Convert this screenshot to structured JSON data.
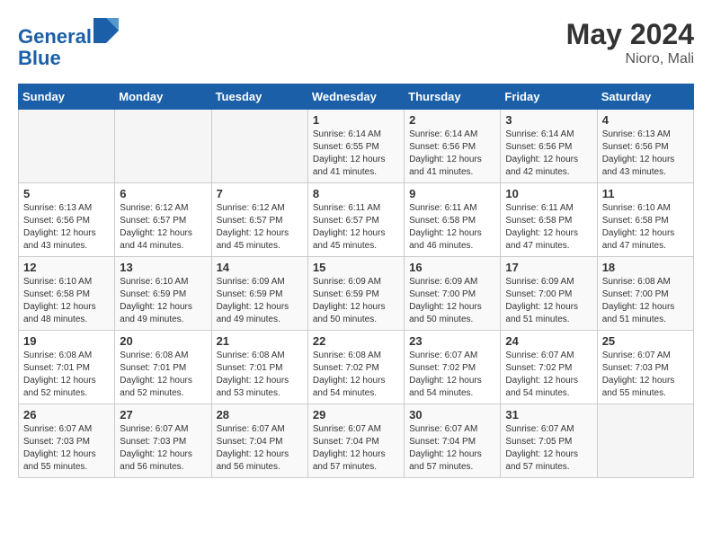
{
  "header": {
    "logo_line1": "General",
    "logo_line2": "Blue",
    "month_year": "May 2024",
    "location": "Nioro, Mali"
  },
  "weekdays": [
    "Sunday",
    "Monday",
    "Tuesday",
    "Wednesday",
    "Thursday",
    "Friday",
    "Saturday"
  ],
  "weeks": [
    [
      {
        "day": "",
        "info": ""
      },
      {
        "day": "",
        "info": ""
      },
      {
        "day": "",
        "info": ""
      },
      {
        "day": "1",
        "info": "Sunrise: 6:14 AM\nSunset: 6:55 PM\nDaylight: 12 hours\nand 41 minutes."
      },
      {
        "day": "2",
        "info": "Sunrise: 6:14 AM\nSunset: 6:56 PM\nDaylight: 12 hours\nand 41 minutes."
      },
      {
        "day": "3",
        "info": "Sunrise: 6:14 AM\nSunset: 6:56 PM\nDaylight: 12 hours\nand 42 minutes."
      },
      {
        "day": "4",
        "info": "Sunrise: 6:13 AM\nSunset: 6:56 PM\nDaylight: 12 hours\nand 43 minutes."
      }
    ],
    [
      {
        "day": "5",
        "info": "Sunrise: 6:13 AM\nSunset: 6:56 PM\nDaylight: 12 hours\nand 43 minutes."
      },
      {
        "day": "6",
        "info": "Sunrise: 6:12 AM\nSunset: 6:57 PM\nDaylight: 12 hours\nand 44 minutes."
      },
      {
        "day": "7",
        "info": "Sunrise: 6:12 AM\nSunset: 6:57 PM\nDaylight: 12 hours\nand 45 minutes."
      },
      {
        "day": "8",
        "info": "Sunrise: 6:11 AM\nSunset: 6:57 PM\nDaylight: 12 hours\nand 45 minutes."
      },
      {
        "day": "9",
        "info": "Sunrise: 6:11 AM\nSunset: 6:58 PM\nDaylight: 12 hours\nand 46 minutes."
      },
      {
        "day": "10",
        "info": "Sunrise: 6:11 AM\nSunset: 6:58 PM\nDaylight: 12 hours\nand 47 minutes."
      },
      {
        "day": "11",
        "info": "Sunrise: 6:10 AM\nSunset: 6:58 PM\nDaylight: 12 hours\nand 47 minutes."
      }
    ],
    [
      {
        "day": "12",
        "info": "Sunrise: 6:10 AM\nSunset: 6:58 PM\nDaylight: 12 hours\nand 48 minutes."
      },
      {
        "day": "13",
        "info": "Sunrise: 6:10 AM\nSunset: 6:59 PM\nDaylight: 12 hours\nand 49 minutes."
      },
      {
        "day": "14",
        "info": "Sunrise: 6:09 AM\nSunset: 6:59 PM\nDaylight: 12 hours\nand 49 minutes."
      },
      {
        "day": "15",
        "info": "Sunrise: 6:09 AM\nSunset: 6:59 PM\nDaylight: 12 hours\nand 50 minutes."
      },
      {
        "day": "16",
        "info": "Sunrise: 6:09 AM\nSunset: 7:00 PM\nDaylight: 12 hours\nand 50 minutes."
      },
      {
        "day": "17",
        "info": "Sunrise: 6:09 AM\nSunset: 7:00 PM\nDaylight: 12 hours\nand 51 minutes."
      },
      {
        "day": "18",
        "info": "Sunrise: 6:08 AM\nSunset: 7:00 PM\nDaylight: 12 hours\nand 51 minutes."
      }
    ],
    [
      {
        "day": "19",
        "info": "Sunrise: 6:08 AM\nSunset: 7:01 PM\nDaylight: 12 hours\nand 52 minutes."
      },
      {
        "day": "20",
        "info": "Sunrise: 6:08 AM\nSunset: 7:01 PM\nDaylight: 12 hours\nand 52 minutes."
      },
      {
        "day": "21",
        "info": "Sunrise: 6:08 AM\nSunset: 7:01 PM\nDaylight: 12 hours\nand 53 minutes."
      },
      {
        "day": "22",
        "info": "Sunrise: 6:08 AM\nSunset: 7:02 PM\nDaylight: 12 hours\nand 54 minutes."
      },
      {
        "day": "23",
        "info": "Sunrise: 6:07 AM\nSunset: 7:02 PM\nDaylight: 12 hours\nand 54 minutes."
      },
      {
        "day": "24",
        "info": "Sunrise: 6:07 AM\nSunset: 7:02 PM\nDaylight: 12 hours\nand 54 minutes."
      },
      {
        "day": "25",
        "info": "Sunrise: 6:07 AM\nSunset: 7:03 PM\nDaylight: 12 hours\nand 55 minutes."
      }
    ],
    [
      {
        "day": "26",
        "info": "Sunrise: 6:07 AM\nSunset: 7:03 PM\nDaylight: 12 hours\nand 55 minutes."
      },
      {
        "day": "27",
        "info": "Sunrise: 6:07 AM\nSunset: 7:03 PM\nDaylight: 12 hours\nand 56 minutes."
      },
      {
        "day": "28",
        "info": "Sunrise: 6:07 AM\nSunset: 7:04 PM\nDaylight: 12 hours\nand 56 minutes."
      },
      {
        "day": "29",
        "info": "Sunrise: 6:07 AM\nSunset: 7:04 PM\nDaylight: 12 hours\nand 57 minutes."
      },
      {
        "day": "30",
        "info": "Sunrise: 6:07 AM\nSunset: 7:04 PM\nDaylight: 12 hours\nand 57 minutes."
      },
      {
        "day": "31",
        "info": "Sunrise: 6:07 AM\nSunset: 7:05 PM\nDaylight: 12 hours\nand 57 minutes."
      },
      {
        "day": "",
        "info": ""
      }
    ]
  ]
}
